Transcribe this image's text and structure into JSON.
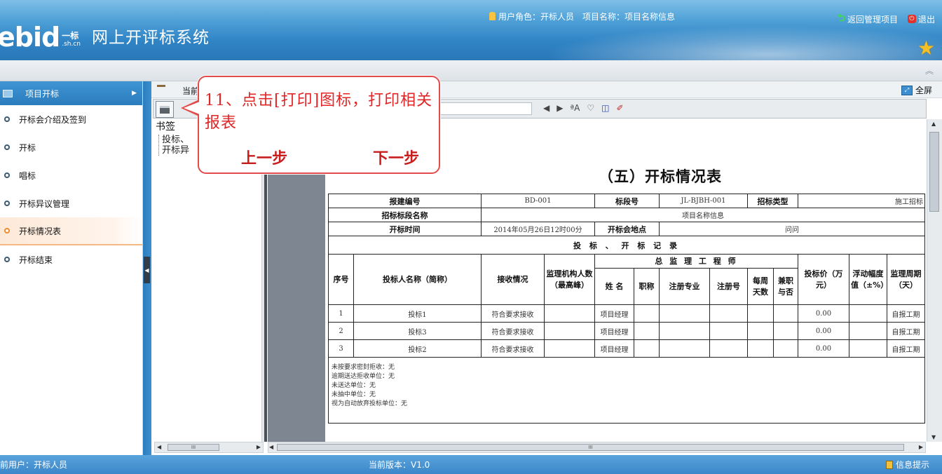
{
  "header": {
    "brand": "ebid",
    "brand_cn": "一标",
    "brand_domain": ".sh.cn",
    "system_title": "网上开评标系统",
    "user_role_label": "用户角色：开标人员",
    "project_label": "项目名称：项目名称信息",
    "back_label": "返回管理项目",
    "exit_label": "退出",
    "colors": {
      "header_top": "#7fc0e8",
      "header_bottom": "#2a78b8",
      "star": "#f4c026"
    }
  },
  "sidebar": {
    "section_title": "项目开标",
    "items": [
      {
        "label": "开标会介绍及签到",
        "active": false
      },
      {
        "label": "开标",
        "active": false
      },
      {
        "label": "唱标",
        "active": false
      },
      {
        "label": "开标异议管理",
        "active": false
      },
      {
        "label": "开标情况表",
        "active": true
      },
      {
        "label": "开标结束",
        "active": false
      }
    ]
  },
  "content": {
    "breadcrumb": "当前",
    "fullscreen_label": "全屏",
    "toolbar_icons": [
      "print-icon",
      "prev-page-icon",
      "next-page-icon",
      "find-text-icon",
      "select-icon",
      "columns-icon",
      "highlight-icon"
    ],
    "bookmark_title": "书签",
    "bookmark_items": [
      "投标、",
      "开标异"
    ]
  },
  "callout": {
    "message": "11、点击[打印]图标，打印相关报表",
    "prev_label": "上一步",
    "next_label": "下一步",
    "color": "#e02626"
  },
  "report": {
    "title": "（五）开标情况表",
    "labels": {
      "project_code": "报建编号",
      "section_code": "标段号",
      "tender_type": "招标类型",
      "section_name": "招标标段名称",
      "open_time": "开标时间",
      "open_place": "开标会地点",
      "section_record": "投 标 、 开 标 记 录",
      "col_no": "序号",
      "col_bidder": "投标人名称（简称）",
      "col_receive": "接收情况",
      "col_staff": "监理机构人数（最高峰）",
      "col_chief": "总 监 理 工 程 师",
      "col_name": "姓 名",
      "col_title": "职称",
      "col_major": "注册专业",
      "col_reg_no": "注册号",
      "col_days": "每周天数",
      "col_parttime": "兼职与否",
      "col_price": "投标价（万元）",
      "col_float": "浮动幅度值（±%）",
      "col_period": "监理周期（天）"
    },
    "values": {
      "project_code": "BD-001",
      "section_code": "JL-BJBH-001",
      "tender_type": "施工招标",
      "section_name": "项目名称信息",
      "open_time": "2014年05月26日12时00分",
      "open_place": "问问"
    },
    "rows": [
      {
        "no": "1",
        "bidder": "投标1",
        "receive": "符合要求接收",
        "name": "项目经理",
        "price": "0.00",
        "period": "自报工期"
      },
      {
        "no": "2",
        "bidder": "投标3",
        "receive": "符合要求接收",
        "name": "项目经理",
        "price": "0.00",
        "period": "自报工期"
      },
      {
        "no": "3",
        "bidder": "投标2",
        "receive": "符合要求接收",
        "name": "项目经理",
        "price": "0.00",
        "period": "自报工期"
      }
    ],
    "notes": [
      "未按要求密封拒收：无",
      "逾期送达拒收单位：无",
      "未送达单位：无",
      "未抽中单位：无",
      "视为自动放弃投标单位：无"
    ]
  },
  "statusbar": {
    "user": "前用户：开标人员",
    "version": "当前版本：V1.0",
    "info_label": "信息提示"
  }
}
